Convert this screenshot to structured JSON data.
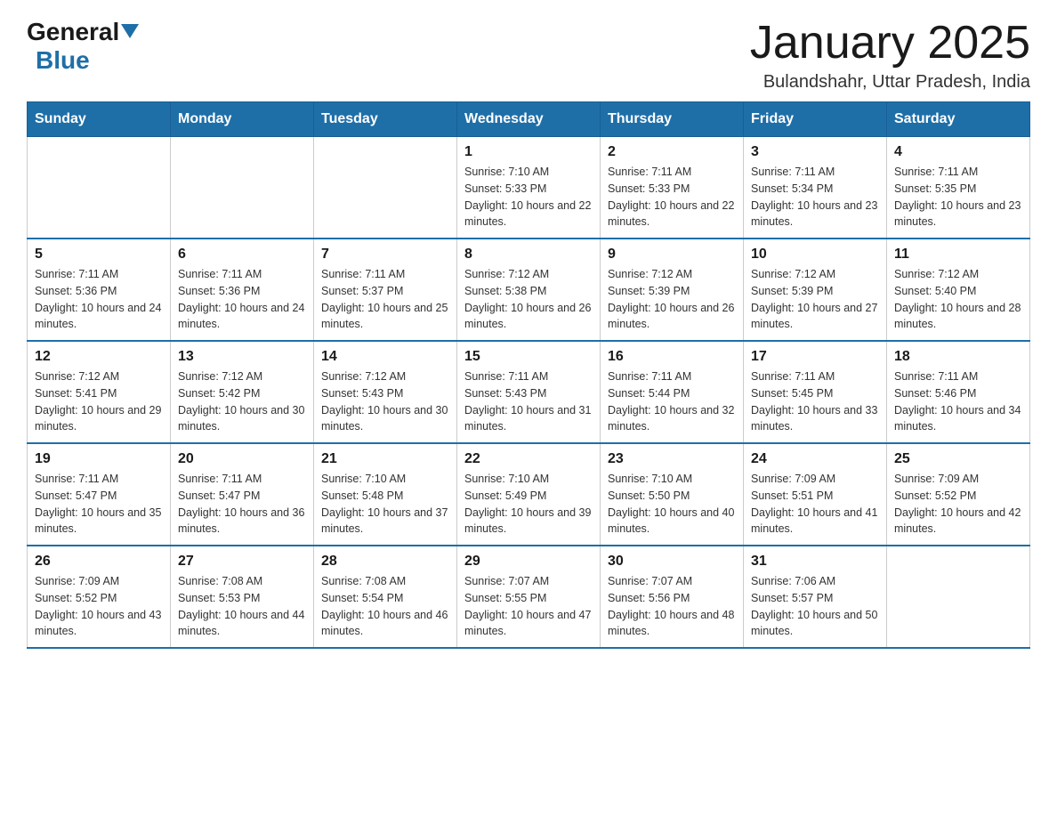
{
  "header": {
    "logo": {
      "general": "General",
      "blue": "Blue"
    },
    "title": "January 2025",
    "location": "Bulandshahr, Uttar Pradesh, India"
  },
  "days_of_week": [
    "Sunday",
    "Monday",
    "Tuesday",
    "Wednesday",
    "Thursday",
    "Friday",
    "Saturday"
  ],
  "weeks": [
    [
      {
        "day": "",
        "info": ""
      },
      {
        "day": "",
        "info": ""
      },
      {
        "day": "",
        "info": ""
      },
      {
        "day": "1",
        "info": "Sunrise: 7:10 AM\nSunset: 5:33 PM\nDaylight: 10 hours and 22 minutes."
      },
      {
        "day": "2",
        "info": "Sunrise: 7:11 AM\nSunset: 5:33 PM\nDaylight: 10 hours and 22 minutes."
      },
      {
        "day": "3",
        "info": "Sunrise: 7:11 AM\nSunset: 5:34 PM\nDaylight: 10 hours and 23 minutes."
      },
      {
        "day": "4",
        "info": "Sunrise: 7:11 AM\nSunset: 5:35 PM\nDaylight: 10 hours and 23 minutes."
      }
    ],
    [
      {
        "day": "5",
        "info": "Sunrise: 7:11 AM\nSunset: 5:36 PM\nDaylight: 10 hours and 24 minutes."
      },
      {
        "day": "6",
        "info": "Sunrise: 7:11 AM\nSunset: 5:36 PM\nDaylight: 10 hours and 24 minutes."
      },
      {
        "day": "7",
        "info": "Sunrise: 7:11 AM\nSunset: 5:37 PM\nDaylight: 10 hours and 25 minutes."
      },
      {
        "day": "8",
        "info": "Sunrise: 7:12 AM\nSunset: 5:38 PM\nDaylight: 10 hours and 26 minutes."
      },
      {
        "day": "9",
        "info": "Sunrise: 7:12 AM\nSunset: 5:39 PM\nDaylight: 10 hours and 26 minutes."
      },
      {
        "day": "10",
        "info": "Sunrise: 7:12 AM\nSunset: 5:39 PM\nDaylight: 10 hours and 27 minutes."
      },
      {
        "day": "11",
        "info": "Sunrise: 7:12 AM\nSunset: 5:40 PM\nDaylight: 10 hours and 28 minutes."
      }
    ],
    [
      {
        "day": "12",
        "info": "Sunrise: 7:12 AM\nSunset: 5:41 PM\nDaylight: 10 hours and 29 minutes."
      },
      {
        "day": "13",
        "info": "Sunrise: 7:12 AM\nSunset: 5:42 PM\nDaylight: 10 hours and 30 minutes."
      },
      {
        "day": "14",
        "info": "Sunrise: 7:12 AM\nSunset: 5:43 PM\nDaylight: 10 hours and 30 minutes."
      },
      {
        "day": "15",
        "info": "Sunrise: 7:11 AM\nSunset: 5:43 PM\nDaylight: 10 hours and 31 minutes."
      },
      {
        "day": "16",
        "info": "Sunrise: 7:11 AM\nSunset: 5:44 PM\nDaylight: 10 hours and 32 minutes."
      },
      {
        "day": "17",
        "info": "Sunrise: 7:11 AM\nSunset: 5:45 PM\nDaylight: 10 hours and 33 minutes."
      },
      {
        "day": "18",
        "info": "Sunrise: 7:11 AM\nSunset: 5:46 PM\nDaylight: 10 hours and 34 minutes."
      }
    ],
    [
      {
        "day": "19",
        "info": "Sunrise: 7:11 AM\nSunset: 5:47 PM\nDaylight: 10 hours and 35 minutes."
      },
      {
        "day": "20",
        "info": "Sunrise: 7:11 AM\nSunset: 5:47 PM\nDaylight: 10 hours and 36 minutes."
      },
      {
        "day": "21",
        "info": "Sunrise: 7:10 AM\nSunset: 5:48 PM\nDaylight: 10 hours and 37 minutes."
      },
      {
        "day": "22",
        "info": "Sunrise: 7:10 AM\nSunset: 5:49 PM\nDaylight: 10 hours and 39 minutes."
      },
      {
        "day": "23",
        "info": "Sunrise: 7:10 AM\nSunset: 5:50 PM\nDaylight: 10 hours and 40 minutes."
      },
      {
        "day": "24",
        "info": "Sunrise: 7:09 AM\nSunset: 5:51 PM\nDaylight: 10 hours and 41 minutes."
      },
      {
        "day": "25",
        "info": "Sunrise: 7:09 AM\nSunset: 5:52 PM\nDaylight: 10 hours and 42 minutes."
      }
    ],
    [
      {
        "day": "26",
        "info": "Sunrise: 7:09 AM\nSunset: 5:52 PM\nDaylight: 10 hours and 43 minutes."
      },
      {
        "day": "27",
        "info": "Sunrise: 7:08 AM\nSunset: 5:53 PM\nDaylight: 10 hours and 44 minutes."
      },
      {
        "day": "28",
        "info": "Sunrise: 7:08 AM\nSunset: 5:54 PM\nDaylight: 10 hours and 46 minutes."
      },
      {
        "day": "29",
        "info": "Sunrise: 7:07 AM\nSunset: 5:55 PM\nDaylight: 10 hours and 47 minutes."
      },
      {
        "day": "30",
        "info": "Sunrise: 7:07 AM\nSunset: 5:56 PM\nDaylight: 10 hours and 48 minutes."
      },
      {
        "day": "31",
        "info": "Sunrise: 7:06 AM\nSunset: 5:57 PM\nDaylight: 10 hours and 50 minutes."
      },
      {
        "day": "",
        "info": ""
      }
    ]
  ]
}
